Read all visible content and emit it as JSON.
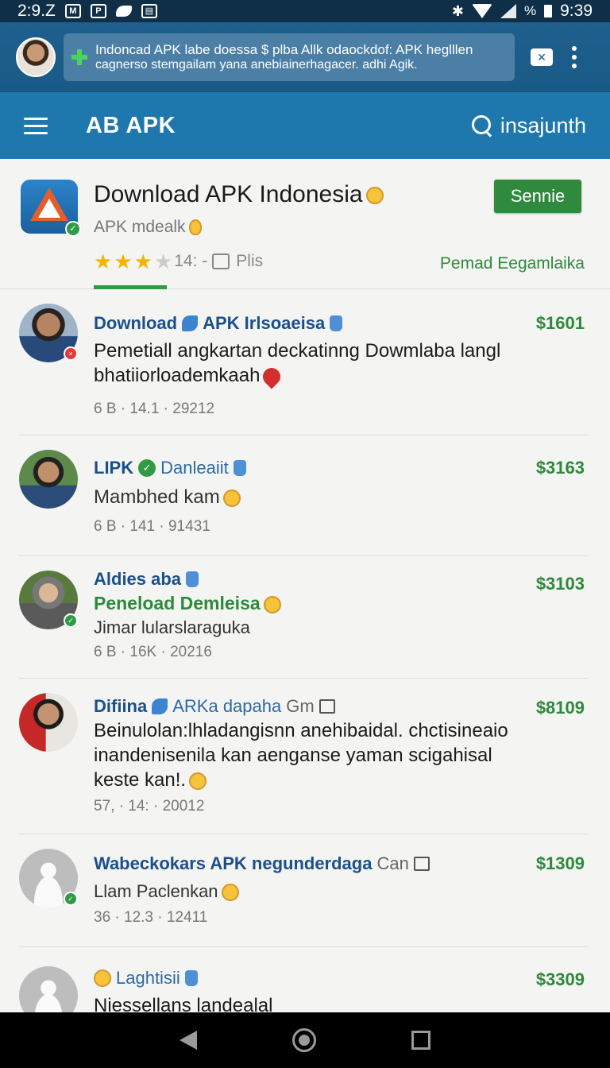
{
  "status_bar": {
    "time_left": "2:9.Z",
    "battery": "%",
    "time_right": "9:39"
  },
  "notification": {
    "line1": "Indoncad APK labe doessa $ plba Allk odaockdof: APK heglllen",
    "line2": "cagnerso stemgailam yana anebiainerhagacer. adhi Agik."
  },
  "appbar": {
    "title": "AB APK",
    "search_text": "insajunth"
  },
  "app": {
    "name": "Download APK Indonesia",
    "subtitle": "APK mdealk",
    "rating_text": "14: -",
    "likes_label": "Plis",
    "install_label": "Sennie",
    "link_label": "Pemad Eegamlaika",
    "stars_filled": 3,
    "stars_total": 4
  },
  "posts": [
    {
      "name": "Download",
      "tag": "APK Irlsoaeisa",
      "price": "$1601",
      "body": "Pemetiall angkartan deckatinng Dowmlaba langl bhatiiorloademkaah",
      "meta": "6 B · 14.1 · 29212"
    },
    {
      "name": "LIPK",
      "tag": "Danleaiit",
      "price": "$3163",
      "body": "Mambhed kam",
      "meta": "6 B · 141 · 91431"
    },
    {
      "name": "Aldies aba",
      "subtitle": "Peneload Demleisa",
      "price": "$3103",
      "body": "Jimar lularslaraguka",
      "meta": "6 B · 16K · 20216"
    },
    {
      "name": "Difiina",
      "tag": "ARKa dapaha",
      "hint": "Gm",
      "price": "$8109",
      "body": "Beinulolan:lhladangisnn anehibaidal. chctisineaio inandenisenila kan aenganse yaman scigahisal keste kan!.",
      "meta": "57, · 14: · 20012"
    },
    {
      "name": "Wabeckokars APK negunderdaga",
      "hint": "Can",
      "price": "$1309",
      "body": "Llam Paclenkan",
      "meta": "36 · 12.3 · 12411"
    },
    {
      "name": "Laghtisii",
      "price": "$3309",
      "body": "Niessellans landealal"
    }
  ],
  "colors": {
    "appbar": "#1f78ad",
    "accent_green": "#2f8a3d",
    "name_blue": "#1b4f8c",
    "star": "#f4b400"
  }
}
